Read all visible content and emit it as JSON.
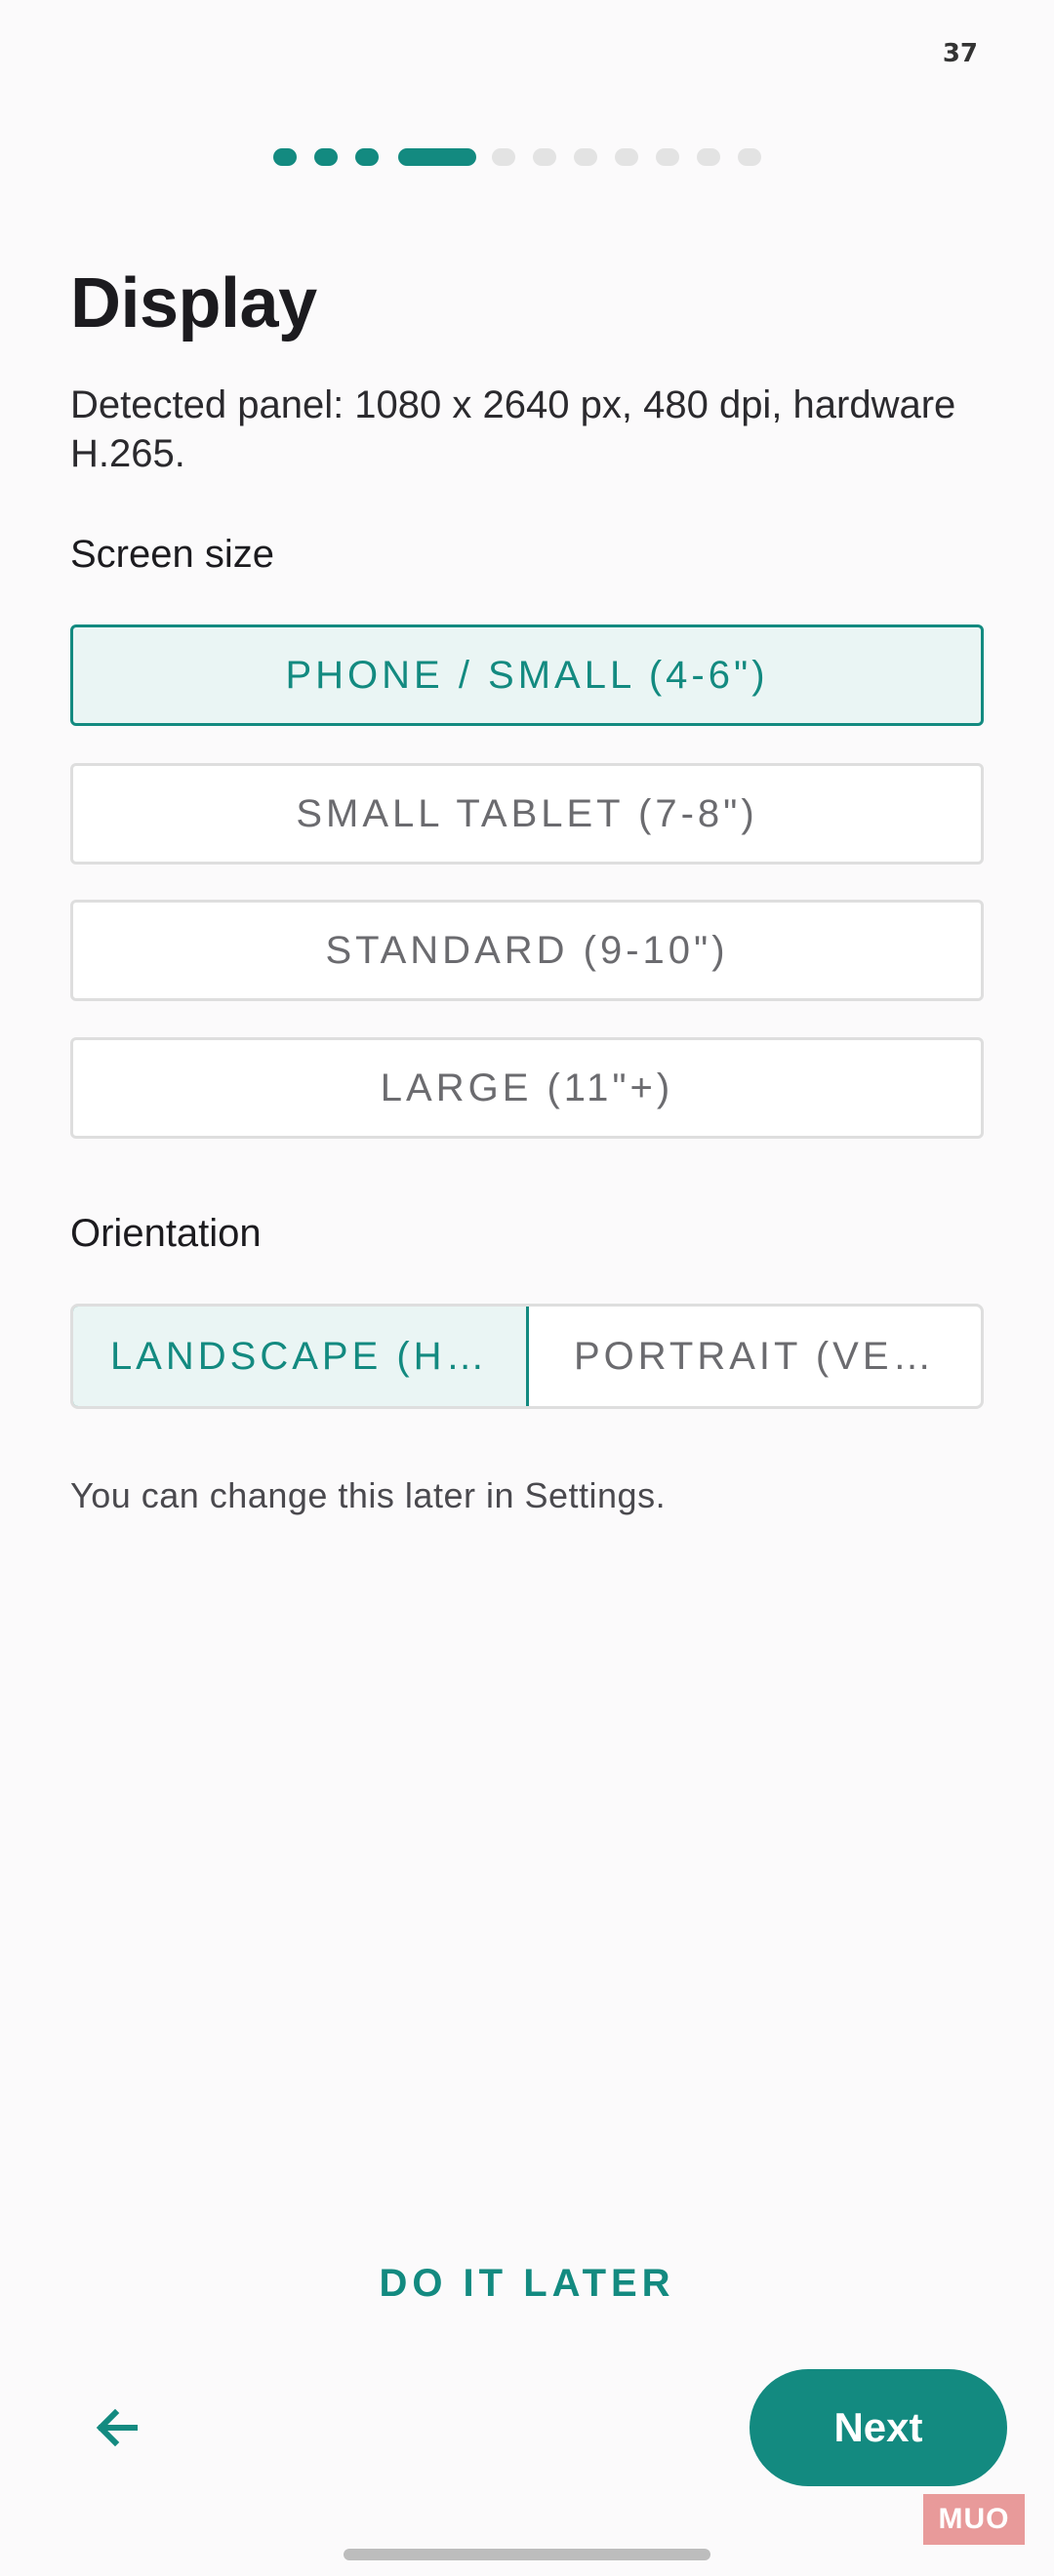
{
  "status_bar": {
    "battery_level": "37"
  },
  "progress": {
    "total_steps": 12,
    "current_step": 4
  },
  "header": {
    "title": "Display",
    "description": "Detected panel: 1080 x 2640 px, 480 dpi, hardware H.265."
  },
  "screen_size": {
    "label": "Screen size",
    "options": [
      {
        "label": "PHONE / SMALL (4-6\")",
        "selected": true
      },
      {
        "label": "SMALL TABLET (7-8\")",
        "selected": false
      },
      {
        "label": "STANDARD (9-10\")",
        "selected": false
      },
      {
        "label": "LARGE (11\"+)",
        "selected": false
      }
    ]
  },
  "orientation": {
    "label": "Orientation",
    "options": [
      {
        "label": "LANDSCAPE (H…",
        "selected": true
      },
      {
        "label": "PORTRAIT (VE…",
        "selected": false
      }
    ]
  },
  "hint": "You can change this later in Settings.",
  "footer": {
    "later_label": "DO IT LATER",
    "next_label": "Next",
    "back_icon": "arrow-left-icon"
  },
  "watermark": "MUO",
  "colors": {
    "accent": "#138a80",
    "selected_bg": "#eaf5f4",
    "inactive_dot": "#e3e3e3"
  }
}
